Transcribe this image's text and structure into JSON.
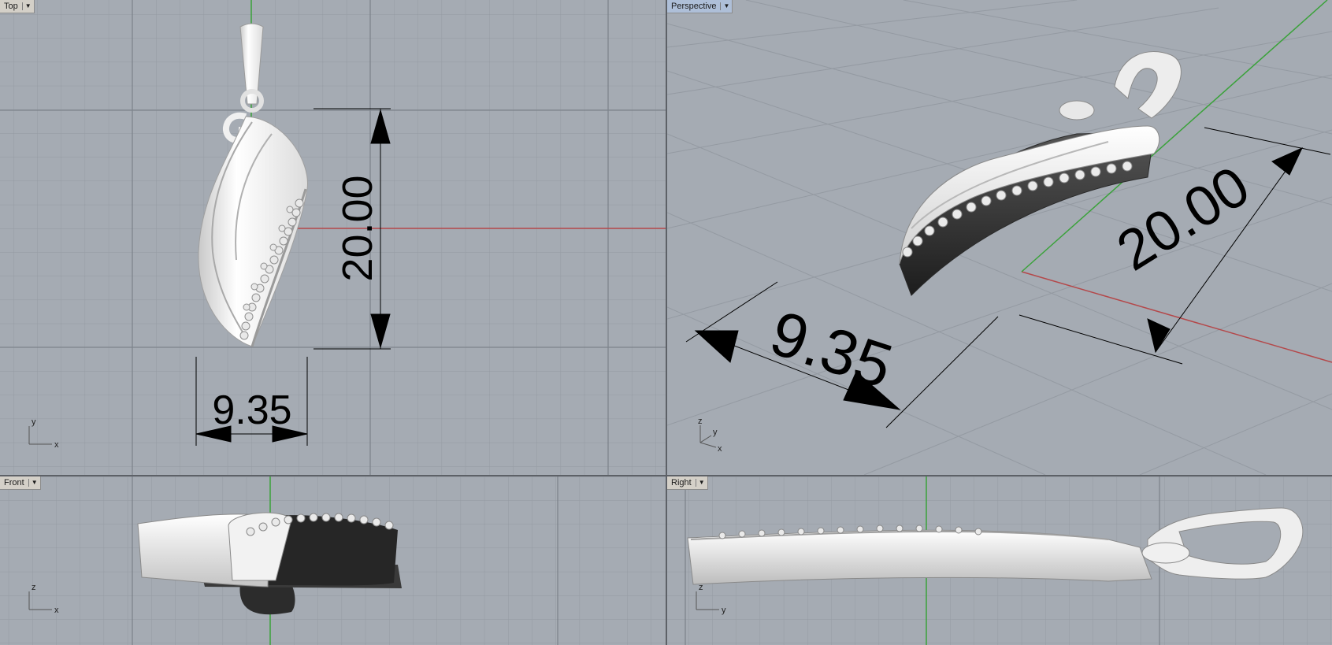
{
  "viewports": {
    "top": {
      "title": "Top",
      "dim_height": "20.00",
      "dim_width": "9.35",
      "axis_x": "x",
      "axis_y": "y"
    },
    "perspective": {
      "title": "Perspective",
      "dim_height": "20.00",
      "dim_width": "9.35",
      "axis_x": "x",
      "axis_y": "y",
      "axis_z": "z"
    },
    "front": {
      "title": "Front",
      "axis_x": "x",
      "axis_z": "z"
    },
    "right": {
      "title": "Right",
      "axis_y": "y",
      "axis_z": "z"
    }
  },
  "icons": {
    "viewport_menu": "chevron-down-icon"
  },
  "colors": {
    "grid_bg": "#a5abb3",
    "x_axis": "#b4484a",
    "y_axis": "#3aa23a",
    "active_title": "#aebfd8"
  }
}
